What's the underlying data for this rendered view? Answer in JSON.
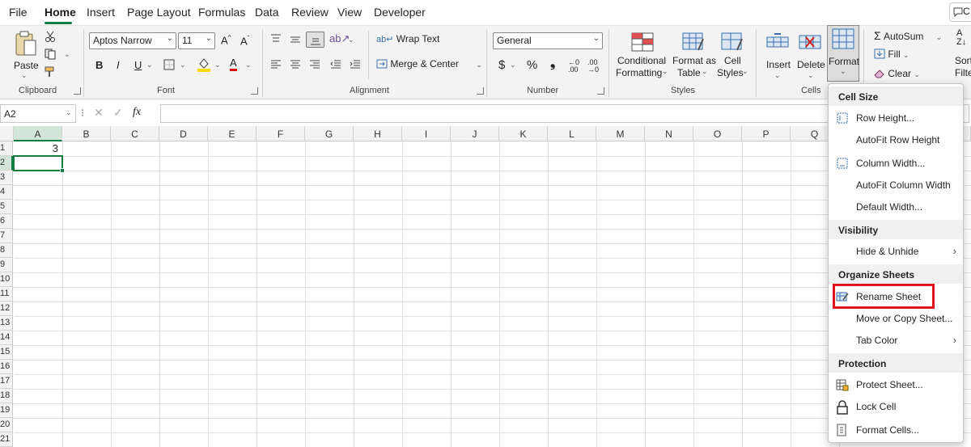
{
  "menu": {
    "tabs": [
      "File",
      "Home",
      "Insert",
      "Page Layout",
      "Formulas",
      "Data",
      "Review",
      "View",
      "Developer"
    ],
    "active": "Home",
    "comments_label": "C"
  },
  "ribbon": {
    "clipboard": {
      "paste": "Paste",
      "group": "Clipboard"
    },
    "font": {
      "name": "Aptos Narrow",
      "size": "11",
      "bold": "B",
      "italic": "I",
      "underline": "U",
      "group": "Font"
    },
    "alignment": {
      "wrap": "Wrap Text",
      "merge": "Merge & Center",
      "group": "Alignment"
    },
    "number": {
      "format": "General",
      "currency": "$",
      "percent": "%",
      "comma": "❟",
      "group": "Number"
    },
    "styles": {
      "conditional_1": "Conditional",
      "conditional_2": "Formatting",
      "table_1": "Format as",
      "table_2": "Table",
      "cell_1": "Cell",
      "cell_2": "Styles",
      "group": "Styles"
    },
    "cells": {
      "insert": "Insert",
      "delete": "Delete",
      "format": "Format",
      "group": "Cells"
    },
    "editing": {
      "autosum": "AutoSum",
      "fill": "Fill",
      "clear": "Clear",
      "sort_1": "Sort",
      "sort_2": "Filte"
    }
  },
  "formula_bar": {
    "name_box": "A2",
    "fx": "fx",
    "value": ""
  },
  "grid": {
    "columns": [
      "A",
      "B",
      "C",
      "D",
      "E",
      "F",
      "G",
      "H",
      "I",
      "J",
      "K",
      "L",
      "M",
      "N",
      "O",
      "P",
      "Q"
    ],
    "rows": [
      "1",
      "2",
      "3",
      "4",
      "5",
      "6",
      "7",
      "8",
      "9",
      "10",
      "11",
      "12",
      "13",
      "14",
      "15",
      "16",
      "17",
      "18",
      "19",
      "20",
      "21"
    ],
    "a1_value": "3",
    "selected_cell": "A2"
  },
  "format_menu": {
    "cell_size": "Cell Size",
    "row_height": "Row Height...",
    "autofit_row": "AutoFit Row Height",
    "column_width": "Column Width...",
    "autofit_col": "AutoFit Column Width",
    "default_width": "Default Width...",
    "visibility": "Visibility",
    "hide_unhide": "Hide & Unhide",
    "organize": "Organize Sheets",
    "rename": "Rename Sheet",
    "move_copy": "Move or Copy Sheet...",
    "tab_color": "Tab Color",
    "protection": "Protection",
    "protect": "Protect Sheet...",
    "lock": "Lock Cell",
    "format_cells": "Format Cells..."
  },
  "colors": {
    "accent": "#107c41",
    "highlight": "#e0141e"
  }
}
